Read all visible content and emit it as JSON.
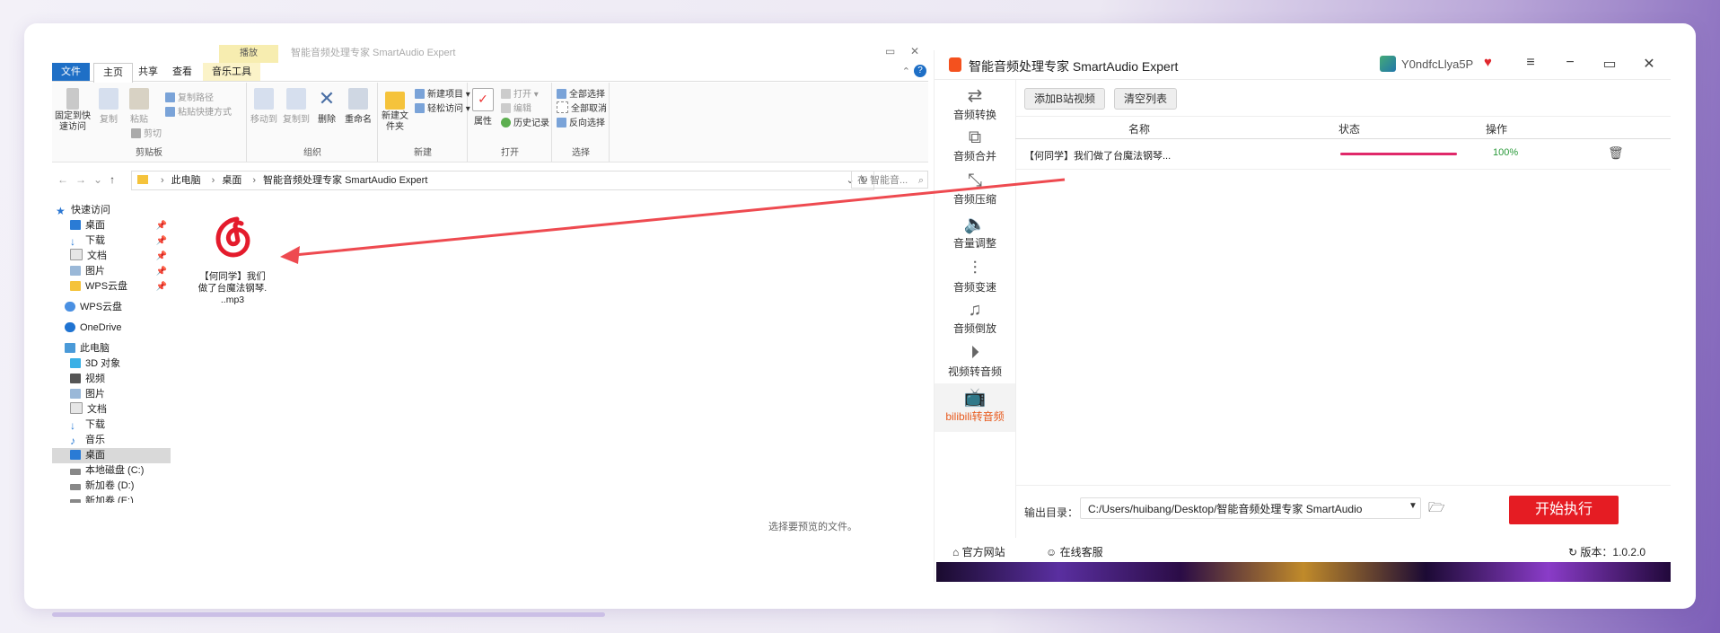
{
  "explorer": {
    "context_tab": "播放",
    "window_title": "智能音频处理专家 SmartAudio Expert",
    "tabs": [
      "文件",
      "主页",
      "共享",
      "查看",
      "音乐工具"
    ],
    "ribbon": {
      "clipboard": {
        "pin": "固定到快速访问",
        "copy": "复制",
        "paste": "粘贴",
        "copy_path": "复制路径",
        "paste_shortcut": "粘贴快捷方式",
        "cut": "剪切",
        "group": "剪贴板"
      },
      "organize": {
        "move_to": "移动到",
        "copy_to": "复制到",
        "delete": "删除",
        "rename": "重命名",
        "group": "组织"
      },
      "new": {
        "new_folder": "新建文件夹",
        "new_item": "新建项目",
        "easy_access": "轻松访问",
        "group": "新建"
      },
      "open": {
        "properties": "属性",
        "open": "打开",
        "edit": "编辑",
        "history": "历史记录",
        "group": "打开"
      },
      "select": {
        "select_all": "全部选择",
        "select_none": "全部取消",
        "invert": "反向选择",
        "group": "选择"
      }
    },
    "address": {
      "crumbs": [
        "此电脑",
        "桌面",
        "智能音频处理专家 SmartAudio Expert"
      ],
      "search_placeholder": "在 智能音..."
    },
    "nav": {
      "quick_access": "快速访问",
      "quick_items": [
        "桌面",
        "下载",
        "文档",
        "图片",
        "WPS云盘"
      ],
      "wps": "WPS云盘",
      "onedrive": "OneDrive",
      "this_pc": "此电脑",
      "pc_items": [
        "3D 对象",
        "视频",
        "图片",
        "文档",
        "下载",
        "音乐",
        "桌面",
        "本地磁盘 (C:)",
        "新加卷 (D:)",
        "新加卷 (E:)"
      ]
    },
    "file": {
      "name_line1": "【何同学】我们",
      "name_line2": "做了台魔法钢琴.",
      "name_line3": "..mp3"
    },
    "preview_msg": "选择要预览的文件。"
  },
  "app": {
    "title": "智能音频处理专家 SmartAudio Expert",
    "user": "Y0ndfcLlya5P",
    "sidebar": [
      "音频转换",
      "音频合并",
      "音频压缩",
      "音量调整",
      "音频变速",
      "音频倒放",
      "视频转音频",
      "bilibili转音频"
    ],
    "toolbar": {
      "add": "添加B站视频",
      "clear": "清空列表"
    },
    "table": {
      "headers": {
        "name": "名称",
        "status": "状态",
        "action": "操作"
      },
      "rows": [
        {
          "name": "【何同学】我们做了台魔法钢琴...",
          "progress": 1.0,
          "percent": "100%"
        }
      ]
    },
    "output": {
      "label": "输出目录：",
      "path": "C:/Users/huibang/Desktop/智能音频处理专家 SmartAudio"
    },
    "start": "开始执行",
    "footer": {
      "site": "官方网站",
      "support": "在线客服",
      "version": "版本：1.0.2.0"
    }
  },
  "colors": {
    "accent": "#e51c23",
    "progress": "#e0286a",
    "bili": "#f06a2a",
    "explorer_file_tab": "#1e6fc6"
  }
}
